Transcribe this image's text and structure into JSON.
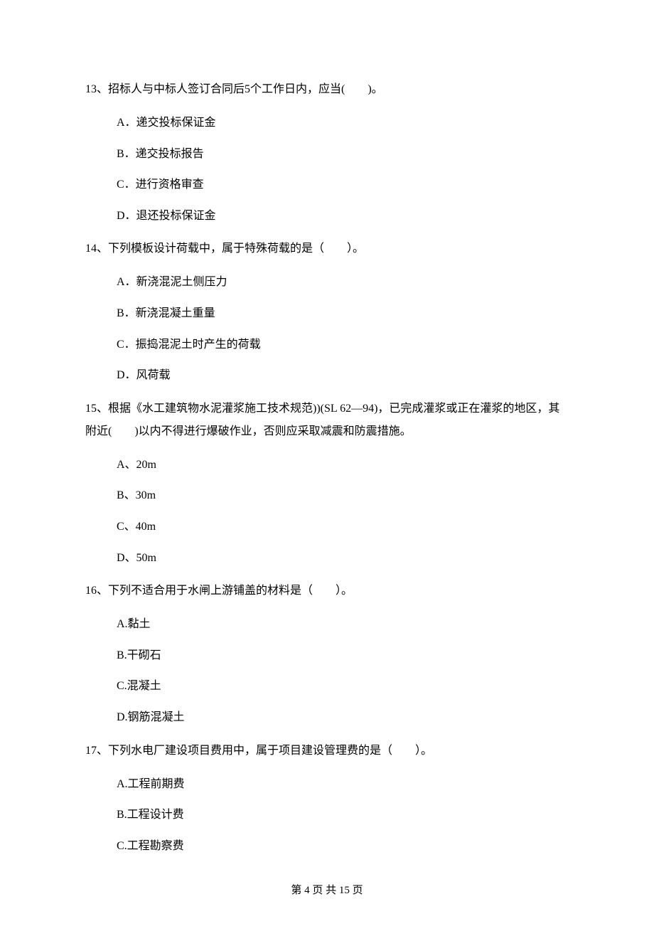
{
  "questions": [
    {
      "number": "13、",
      "text": "招标人与中标人签订合同后5个工作日内，应当(　　)。",
      "options": [
        "A．递交投标保证金",
        "B．递交投标报告",
        "C．进行资格审查",
        "D．退还投标保证金"
      ]
    },
    {
      "number": "14、",
      "text": "下列模板设计荷载中，属于特殊荷载的是（　　）。",
      "options": [
        "A．新浇混泥土侧压力",
        "B．新浇混凝土重量",
        "C．振捣混泥土时产生的荷载",
        "D．风荷载"
      ]
    },
    {
      "number": "15、",
      "text": "根据《水工建筑物水泥灌浆施工技术规范))(SL 62—94)，已完成灌浆或正在灌浆的地区，其附近(　　)以内不得进行爆破作业，否则应采取减震和防震措施。",
      "options": [
        "A、20m",
        "B、30m",
        "C、40m",
        "D、50m"
      ]
    },
    {
      "number": "16、",
      "text": "下列不适合用于水闸上游铺盖的材料是（　　）。",
      "options": [
        "A.黏土",
        "B.干砌石",
        "C.混凝土",
        "D.钢筋混凝土"
      ]
    },
    {
      "number": "17、",
      "text": "下列水电厂建设项目费用中，属于项目建设管理费的是（　　）。",
      "options": [
        "A.工程前期费",
        "B.工程设计费",
        "C.工程勘察费"
      ]
    }
  ],
  "footer": "第 4 页 共 15 页"
}
